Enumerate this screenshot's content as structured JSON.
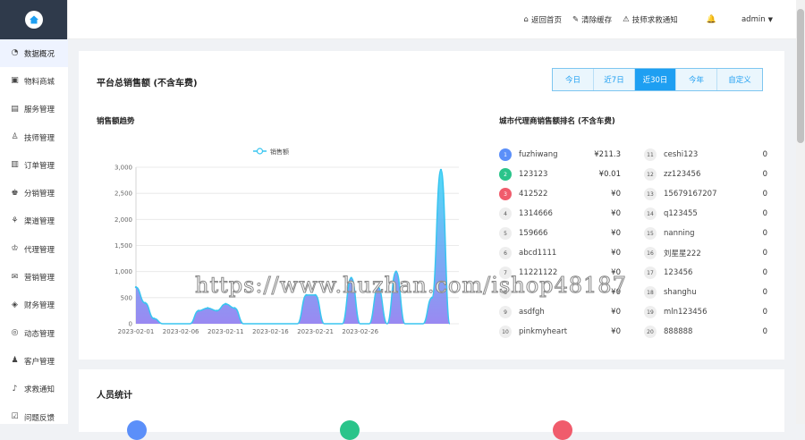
{
  "top": {
    "links": [
      {
        "icon": "home-icon",
        "label": "返回首页"
      },
      {
        "icon": "broom-icon",
        "label": "清除缓存"
      },
      {
        "icon": "alarm-icon",
        "label": "技师求救通知"
      }
    ],
    "user": "admin"
  },
  "sidebar": {
    "items": [
      {
        "icon": "dashboard-icon",
        "label": "数据概况",
        "active": true
      },
      {
        "icon": "shop-icon",
        "label": "物料商城"
      },
      {
        "icon": "service-icon",
        "label": "服务管理"
      },
      {
        "icon": "technician-icon",
        "label": "技师管理"
      },
      {
        "icon": "order-icon",
        "label": "订单管理"
      },
      {
        "icon": "distribution-icon",
        "label": "分销管理"
      },
      {
        "icon": "channel-icon",
        "label": "渠道管理"
      },
      {
        "icon": "agent-icon",
        "label": "代理管理"
      },
      {
        "icon": "marketing-icon",
        "label": "营销管理"
      },
      {
        "icon": "finance-icon",
        "label": "财务管理"
      },
      {
        "icon": "dynamic-icon",
        "label": "动态管理"
      },
      {
        "icon": "customer-icon",
        "label": "客户管理"
      },
      {
        "icon": "bell-icon",
        "label": "求救通知"
      },
      {
        "icon": "feedback-icon",
        "label": "问题反馈"
      }
    ]
  },
  "sales": {
    "title": "平台总销售额 (不含车费)",
    "tabs": [
      "今日",
      "近7日",
      "近30日",
      "今年",
      "自定义"
    ],
    "active_tab": 2,
    "trend_title": "销售额趋势",
    "rank_title": "城市代理商销售额排名 (不含车费)"
  },
  "chart_data": {
    "type": "area",
    "series": [
      {
        "name": "销售额",
        "values": [
          700,
          400,
          100,
          0,
          0,
          0,
          0,
          250,
          300,
          250,
          380,
          300,
          0,
          0,
          0,
          0,
          0,
          0,
          0,
          550,
          550,
          0,
          0,
          0,
          880,
          0,
          0,
          700,
          0,
          1000,
          0,
          0,
          0,
          500,
          2950,
          0
        ]
      }
    ],
    "x": [
      "2023-02-01",
      "",
      "",
      "",
      "",
      "2023-02-06",
      "",
      "",
      "",
      "",
      "2023-02-11",
      "",
      "",
      "",
      "",
      "2023-02-16",
      "",
      "",
      "",
      "",
      "2023-02-21",
      "",
      "",
      "",
      "",
      "2023-02-26",
      "",
      "",
      "",
      ""
    ],
    "x_ticks": [
      "2023-02-01",
      "2023-02-06",
      "2023-02-11",
      "2023-02-16",
      "2023-02-21",
      "2023-02-26"
    ],
    "y_ticks": [
      "0",
      "500",
      "1,000",
      "1,500",
      "2,000",
      "2,500",
      "3,000"
    ],
    "ylim": [
      0,
      3000
    ],
    "legend": "top-center",
    "grid": true,
    "color": "#39c5f0"
  },
  "ranking": [
    {
      "rank": "1",
      "name": "fuzhiwang",
      "value": "¥211.3"
    },
    {
      "rank": "2",
      "name": "123123",
      "value": "¥0.01"
    },
    {
      "rank": "3",
      "name": "412522",
      "value": "¥0"
    },
    {
      "rank": "4",
      "name": "1314666",
      "value": "¥0"
    },
    {
      "rank": "5",
      "name": "159666",
      "value": "¥0"
    },
    {
      "rank": "6",
      "name": "abcd1111",
      "value": "¥0"
    },
    {
      "rank": "7",
      "name": "11221122",
      "value": "¥0"
    },
    {
      "rank": "8",
      "name": "",
      "value": "¥0"
    },
    {
      "rank": "9",
      "name": "asdfgh",
      "value": "¥0"
    },
    {
      "rank": "10",
      "name": "pinkmyheart",
      "value": "¥0"
    },
    {
      "rank": "11",
      "name": "ceshi123",
      "value": "0"
    },
    {
      "rank": "12",
      "name": "zz123456",
      "value": "0"
    },
    {
      "rank": "13",
      "name": "15679167207",
      "value": "0"
    },
    {
      "rank": "14",
      "name": "q123455",
      "value": "0"
    },
    {
      "rank": "15",
      "name": "nanning",
      "value": "0"
    },
    {
      "rank": "16",
      "name": "刘星星222",
      "value": "0"
    },
    {
      "rank": "17",
      "name": "123456",
      "value": "0"
    },
    {
      "rank": "18",
      "name": "shanghu",
      "value": "0"
    },
    {
      "rank": "19",
      "name": "mln123456",
      "value": "0"
    },
    {
      "rank": "20",
      "name": "888888",
      "value": "0"
    }
  ],
  "staff": {
    "title": "人员统计"
  },
  "watermark": "https://www.huzhan.com/ishop48187"
}
